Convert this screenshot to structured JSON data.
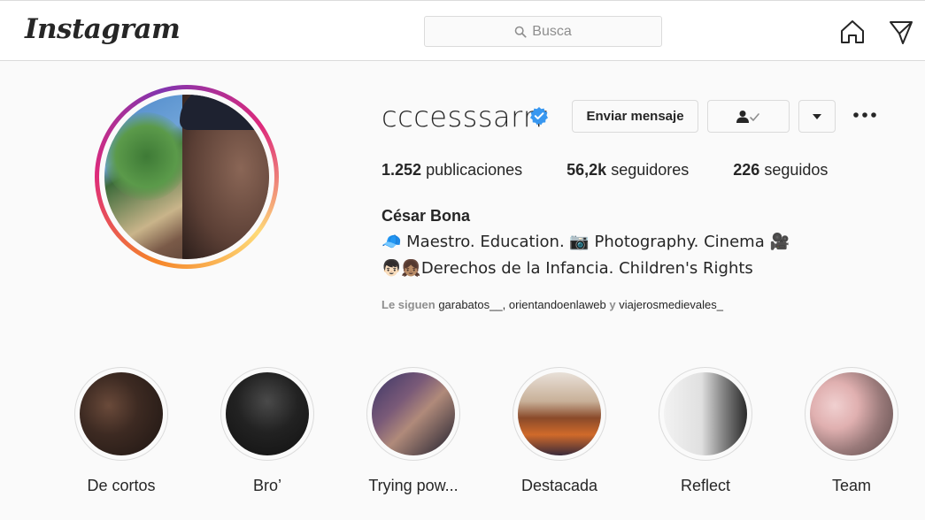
{
  "header": {
    "logo": "Instagram",
    "search_placeholder": "Busca"
  },
  "profile": {
    "username": "cccesssarrr",
    "verified": true,
    "buttons": {
      "message": "Enviar mensaje"
    },
    "stats": {
      "posts_count": "1.252",
      "posts_label": "publicaciones",
      "followers_count": "56,2k",
      "followers_label": "seguidores",
      "following_count": "226",
      "following_label": "seguidos"
    },
    "full_name": "César Bona",
    "bio_line1": "🧢 Maestro. Education. 📷 Photography. Cinema 🎥",
    "bio_line2": "👦🏻👧🏽Derechos de la Infancia. Children's Rights",
    "followed_by": {
      "prefix": "Le siguen",
      "account1": "garabatos__",
      "account2": "orientandoenlaweb",
      "conjunction": "y",
      "account3": "viajerosmedievales_"
    }
  },
  "highlights": [
    {
      "label": "De cortos"
    },
    {
      "label": "Bro’"
    },
    {
      "label": "Trying pow..."
    },
    {
      "label": "Destacada"
    },
    {
      "label": "Reflect"
    },
    {
      "label": "Team"
    }
  ],
  "colors": {
    "verified_blue": "#3897f0",
    "border": "#dbdbdb",
    "muted_text": "#8e8e8e"
  }
}
